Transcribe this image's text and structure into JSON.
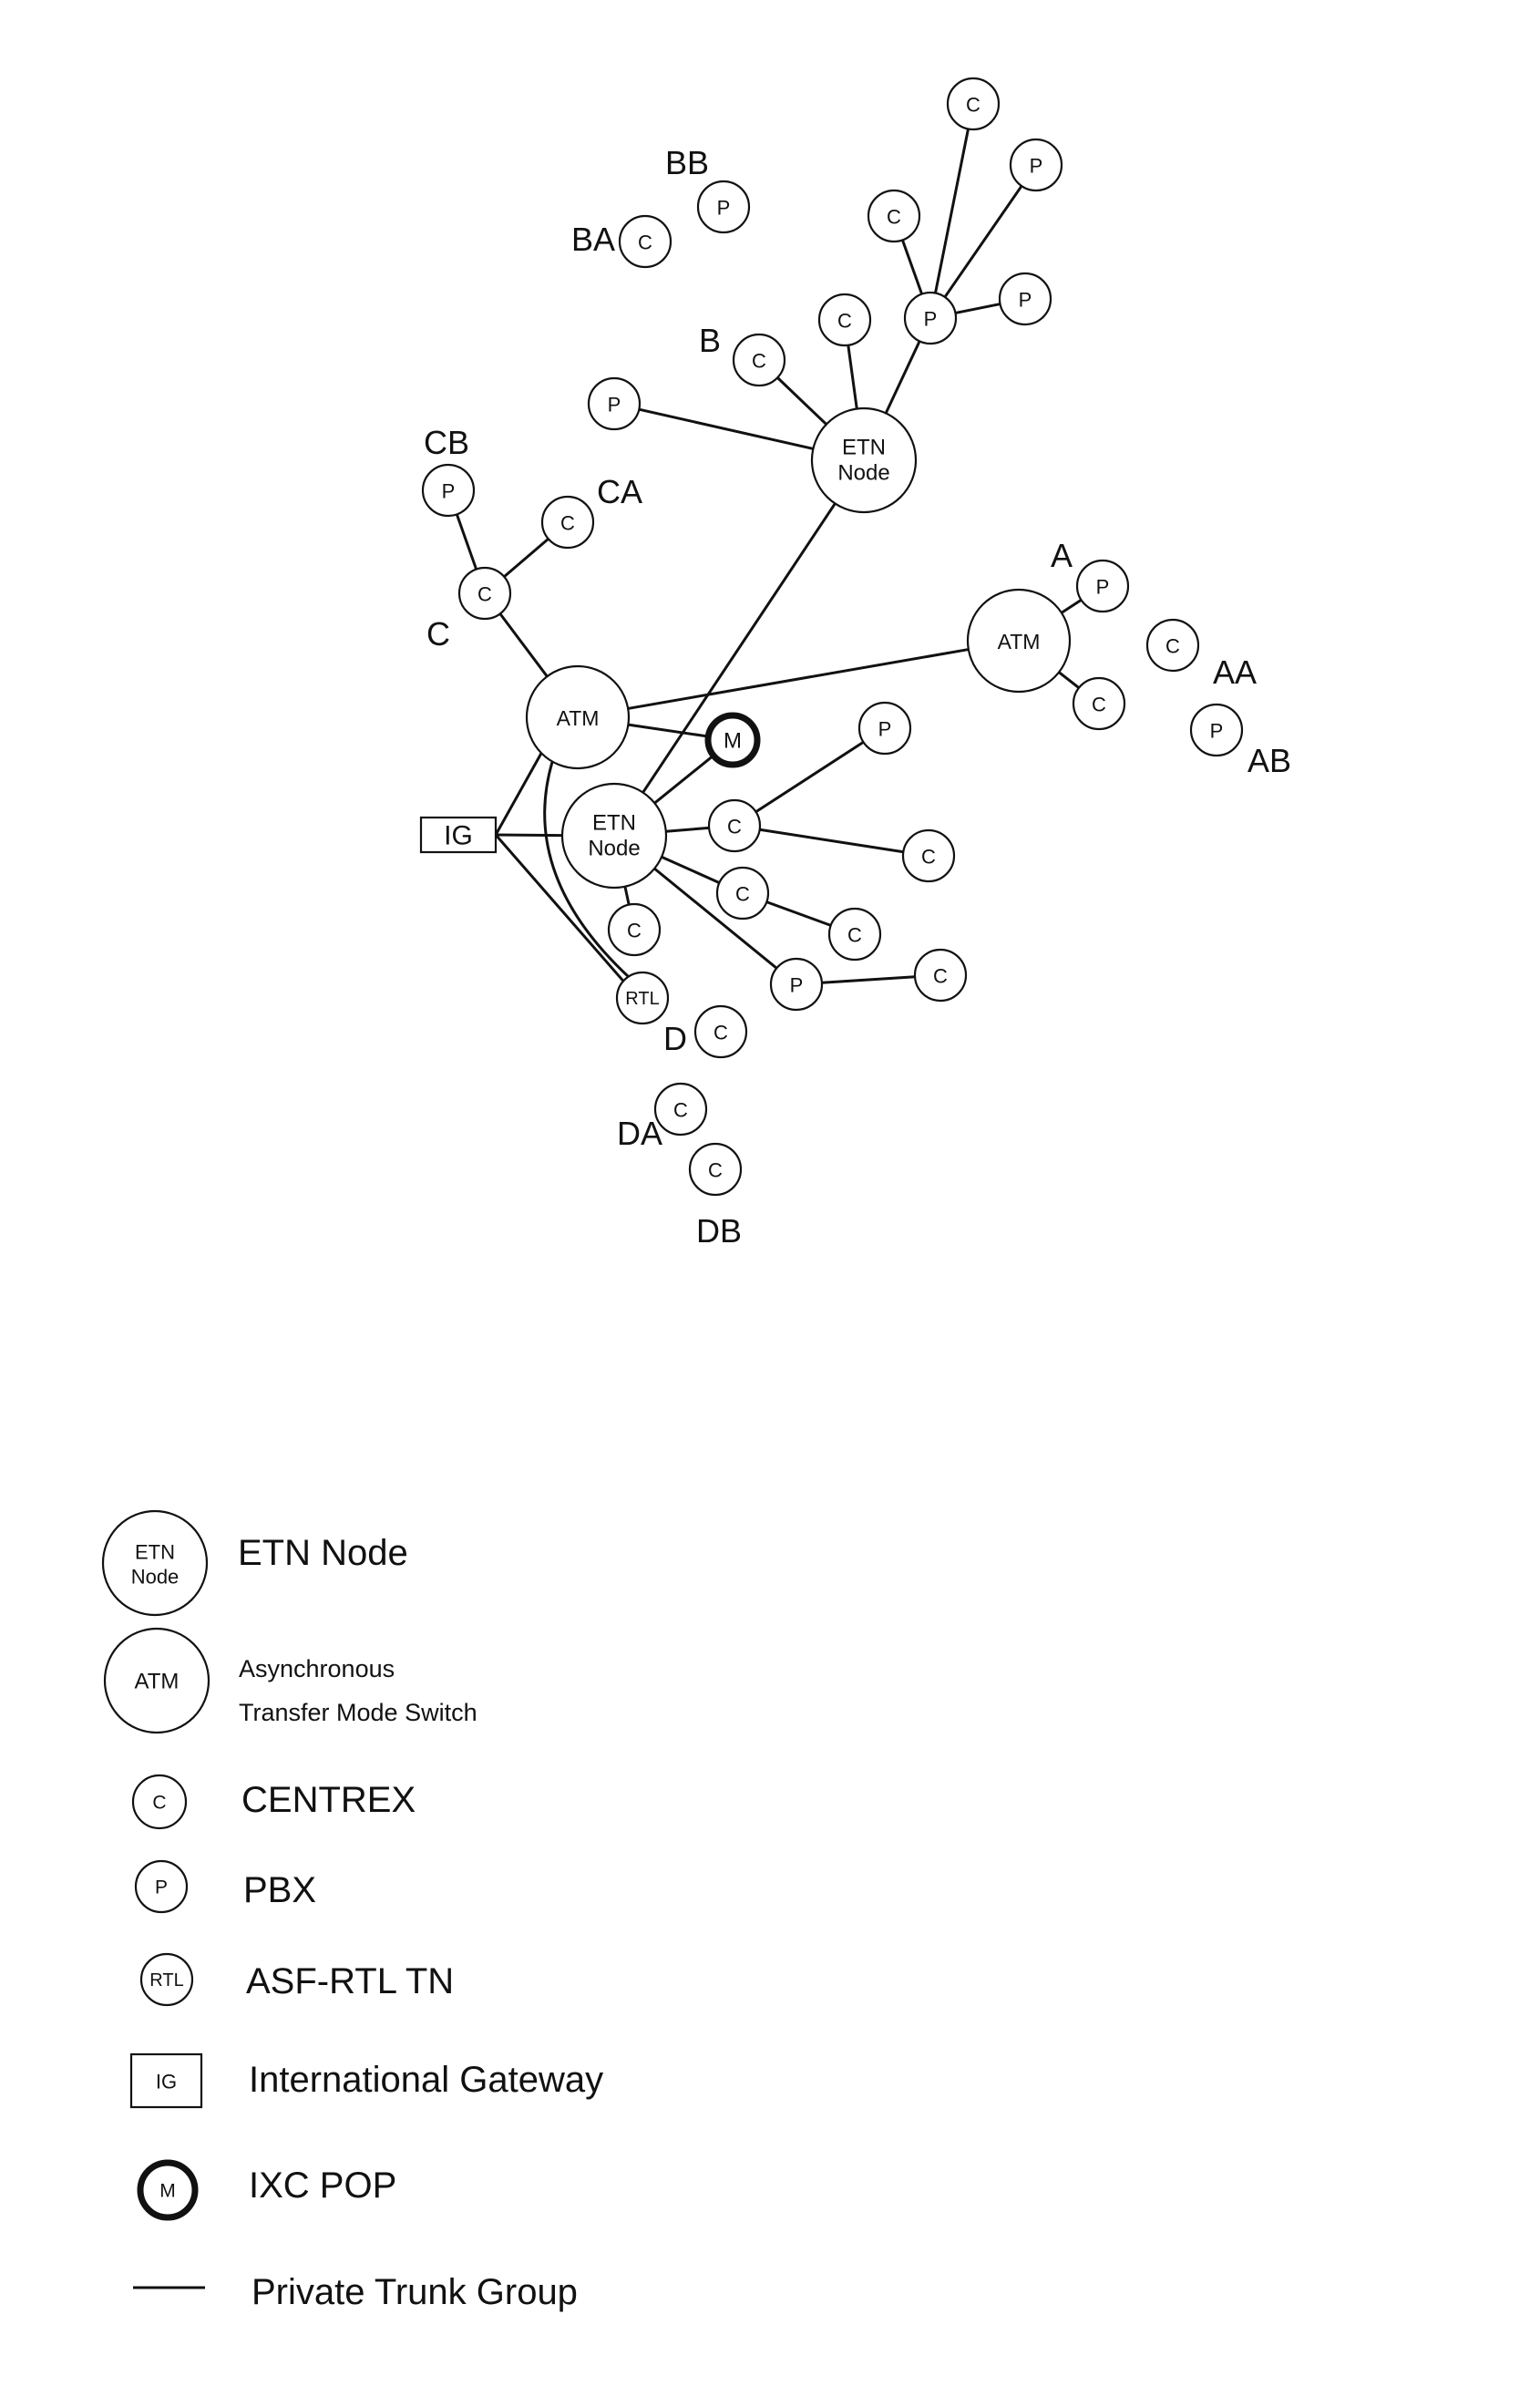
{
  "diagram": {
    "nodes": [
      {
        "id": "etn1",
        "type": "etn",
        "text": [
          "ETN",
          "Node"
        ]
      },
      {
        "id": "etn2",
        "type": "etn",
        "text": [
          "ETN",
          "Node"
        ]
      },
      {
        "id": "atm1",
        "type": "atm",
        "text": [
          "ATM"
        ]
      },
      {
        "id": "atm2",
        "type": "atm",
        "text": [
          "ATM"
        ]
      },
      {
        "id": "ixc",
        "type": "ixc",
        "text": [
          "M"
        ]
      },
      {
        "id": "ig",
        "type": "ig",
        "text": [
          "IG"
        ]
      },
      {
        "id": "rtl",
        "type": "rtl",
        "text": [
          "RTL"
        ]
      },
      {
        "id": "b_p_left",
        "type": "pbx",
        "text": [
          "P"
        ]
      },
      {
        "id": "b_c",
        "type": "centrex",
        "text": [
          "C"
        ]
      },
      {
        "id": "b_c2",
        "type": "centrex",
        "text": [
          "C"
        ]
      },
      {
        "id": "b_p_hub",
        "type": "pbx",
        "text": [
          "P"
        ]
      },
      {
        "id": "b_c_up",
        "type": "centrex",
        "text": [
          "C"
        ]
      },
      {
        "id": "b_c_top",
        "type": "centrex",
        "text": [
          "C"
        ]
      },
      {
        "id": "b_p_ur",
        "type": "pbx",
        "text": [
          "P"
        ]
      },
      {
        "id": "b_p_r",
        "type": "pbx",
        "text": [
          "P"
        ]
      },
      {
        "id": "ba_c",
        "type": "centrex",
        "text": [
          "C"
        ]
      },
      {
        "id": "bb_p",
        "type": "pbx",
        "text": [
          "P"
        ]
      },
      {
        "id": "cb_p",
        "type": "pbx",
        "text": [
          "P"
        ]
      },
      {
        "id": "ca_c",
        "type": "centrex",
        "text": [
          "C"
        ]
      },
      {
        "id": "c_c",
        "type": "centrex",
        "text": [
          "C"
        ]
      },
      {
        "id": "a_p",
        "type": "pbx",
        "text": [
          "P"
        ]
      },
      {
        "id": "a_c",
        "type": "centrex",
        "text": [
          "C"
        ]
      },
      {
        "id": "aa_c",
        "type": "centrex",
        "text": [
          "C"
        ]
      },
      {
        "id": "ab_p",
        "type": "pbx",
        "text": [
          "P"
        ]
      },
      {
        "id": "l_p",
        "type": "pbx",
        "text": [
          "P"
        ]
      },
      {
        "id": "l_c1",
        "type": "centrex",
        "text": [
          "C"
        ]
      },
      {
        "id": "l_c1_far",
        "type": "centrex",
        "text": [
          "C"
        ]
      },
      {
        "id": "l_c2",
        "type": "centrex",
        "text": [
          "C"
        ]
      },
      {
        "id": "l_c2_far",
        "type": "centrex",
        "text": [
          "C"
        ]
      },
      {
        "id": "l_c_below",
        "type": "centrex",
        "text": [
          "C"
        ]
      },
      {
        "id": "l_p_bottom",
        "type": "pbx",
        "text": [
          "P"
        ]
      },
      {
        "id": "l_c_bottom_far",
        "type": "centrex",
        "text": [
          "C"
        ]
      },
      {
        "id": "d_c",
        "type": "centrex",
        "text": [
          "C"
        ]
      },
      {
        "id": "da_c",
        "type": "centrex",
        "text": [
          "C"
        ]
      },
      {
        "id": "db_c",
        "type": "centrex",
        "text": [
          "C"
        ]
      }
    ],
    "edges": [
      [
        "etn1",
        "b_p_left"
      ],
      [
        "etn1",
        "b_c"
      ],
      [
        "etn1",
        "b_c2"
      ],
      [
        "etn1",
        "b_p_hub"
      ],
      [
        "b_p_hub",
        "b_c_up"
      ],
      [
        "b_p_hub",
        "b_c_top"
      ],
      [
        "b_p_hub",
        "b_p_ur"
      ],
      [
        "b_p_hub",
        "b_p_r"
      ],
      [
        "etn1",
        "etn2"
      ],
      [
        "cb_p",
        "c_c"
      ],
      [
        "ca_c",
        "c_c"
      ],
      [
        "c_c",
        "atm1"
      ],
      [
        "atm1",
        "atm2"
      ],
      [
        "atm2",
        "a_p"
      ],
      [
        "atm2",
        "a_c"
      ],
      [
        "atm1",
        "ixc"
      ],
      [
        "etn2",
        "ixc"
      ],
      [
        "ig",
        "atm1"
      ],
      [
        "ig",
        "etn2"
      ],
      [
        "ig",
        "rtl"
      ],
      [
        "etn2",
        "l_c1"
      ],
      [
        "l_c1",
        "l_p"
      ],
      [
        "l_c1",
        "l_c1_far"
      ],
      [
        "etn2",
        "l_c2"
      ],
      [
        "l_c2",
        "l_c2_far"
      ],
      [
        "etn2",
        "l_c_below"
      ],
      [
        "etn2",
        "l_p_bottom"
      ],
      [
        "l_p_bottom",
        "l_c_bottom_far"
      ]
    ],
    "curved_edges": [
      [
        "atm1",
        "rtl"
      ]
    ],
    "group_labels": [
      {
        "id": "A",
        "text": "A"
      },
      {
        "id": "AA",
        "text": "AA"
      },
      {
        "id": "AB",
        "text": "AB"
      },
      {
        "id": "B",
        "text": "B"
      },
      {
        "id": "BA",
        "text": "BA"
      },
      {
        "id": "BB",
        "text": "BB"
      },
      {
        "id": "C",
        "text": "C"
      },
      {
        "id": "CA",
        "text": "CA"
      },
      {
        "id": "CB",
        "text": "CB"
      },
      {
        "id": "D",
        "text": "D"
      },
      {
        "id": "DA",
        "text": "DA"
      },
      {
        "id": "DB",
        "text": "DB"
      }
    ]
  },
  "legend": {
    "items": [
      {
        "id": "etn",
        "symbol_text": [
          "ETN",
          "Node"
        ],
        "label": [
          "ETN Node"
        ]
      },
      {
        "id": "atm",
        "symbol_text": [
          "ATM"
        ],
        "label": [
          "Asynchronous",
          "Transfer Mode Switch"
        ]
      },
      {
        "id": "centrex",
        "symbol_text": [
          "C"
        ],
        "label": [
          "CENTREX"
        ]
      },
      {
        "id": "pbx",
        "symbol_text": [
          "P"
        ],
        "label": [
          "PBX"
        ]
      },
      {
        "id": "rtl",
        "symbol_text": [
          "RTL"
        ],
        "label": [
          "ASF-RTL TN"
        ]
      },
      {
        "id": "ig",
        "symbol_text": [
          "IG"
        ],
        "label": [
          "International Gateway"
        ]
      },
      {
        "id": "ixc",
        "symbol_text": [
          "M"
        ],
        "label": [
          "IXC POP"
        ]
      },
      {
        "id": "trunk",
        "symbol_text": [],
        "label": [
          "Private Trunk Group"
        ]
      }
    ]
  }
}
